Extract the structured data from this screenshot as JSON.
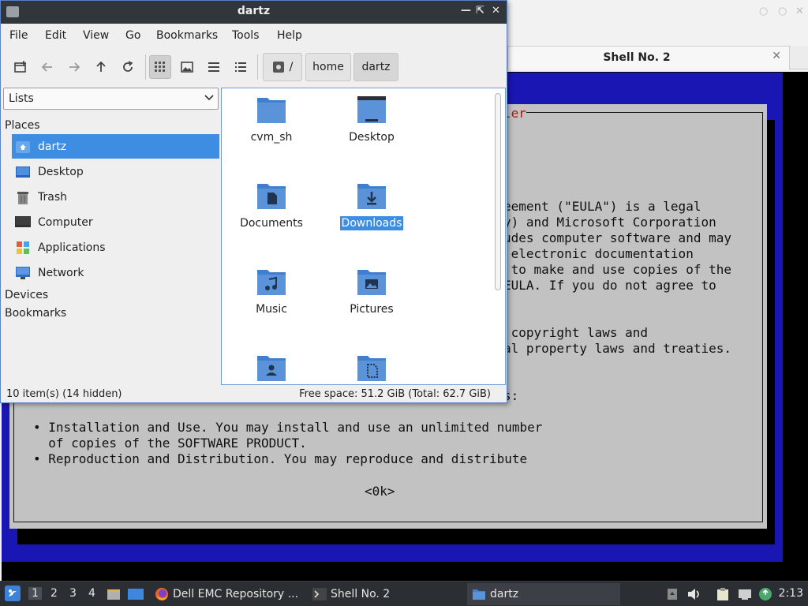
{
  "terminal": {
    "tab_label": "Shell No. 2",
    "dialog_title_fragment": "ler",
    "lines": [
      "eement (\"EULA\") is a legal",
      "y) and Microsoft Corporation",
      "udes computer software and may",
      " electronic documentation",
      " to make and use copies of the",
      "EULA. If you do not agree to",
      "",
      " copyright laws and",
      "al property laws and treaties.",
      "",
      "s:"
    ],
    "bullets": [
      "• Installation and Use. You may install and use an unlimited number",
      "  of copies of the SOFTWARE PRODUCT.",
      "• Reproduction and Distribution. You may reproduce and distribute"
    ],
    "ok_button": "<0k>"
  },
  "file_manager": {
    "title": "dartz",
    "menu": [
      "File",
      "Edit",
      "View",
      "Go",
      "Bookmarks",
      "Tools",
      "Help"
    ],
    "breadcrumb": {
      "root": "/",
      "items": [
        "home",
        "dartz"
      ]
    },
    "side_combo": "Lists",
    "side_sections": {
      "places": "Places",
      "devices": "Devices",
      "bookmarks": "Bookmarks"
    },
    "places": [
      {
        "label": "dartz",
        "icon": "home-folder-icon"
      },
      {
        "label": "Desktop",
        "icon": "desktop-icon"
      },
      {
        "label": "Trash",
        "icon": "trash-icon"
      },
      {
        "label": "Computer",
        "icon": "computer-icon"
      },
      {
        "label": "Applications",
        "icon": "applications-icon"
      },
      {
        "label": "Network",
        "icon": "network-icon"
      }
    ],
    "files": [
      {
        "name": "cvm_sh",
        "icon": "folder-icon"
      },
      {
        "name": "Desktop",
        "icon": "desktop-folder-icon"
      },
      {
        "name": "Documents",
        "icon": "documents-folder-icon"
      },
      {
        "name": "Downloads",
        "icon": "downloads-folder-icon"
      },
      {
        "name": "Music",
        "icon": "music-folder-icon"
      },
      {
        "name": "Pictures",
        "icon": "pictures-folder-icon"
      },
      {
        "name": "",
        "icon": "public-folder-icon"
      },
      {
        "name": "",
        "icon": "templates-folder-icon"
      }
    ],
    "selected_file": "Downloads",
    "status_left": "10 item(s) (14 hidden)",
    "status_right": "Free space: 51.2 GiB (Total: 62.7 GiB)"
  },
  "taskbar": {
    "workspaces": [
      "1",
      "2",
      "3",
      "4"
    ],
    "tasks": [
      {
        "label": "Dell EMC Repository ...",
        "icon": "firefox-icon"
      },
      {
        "label": "Shell No. 2",
        "icon": "terminal-icon"
      },
      {
        "label": "dartz",
        "icon": "folder-icon"
      }
    ],
    "clock": "2:13"
  },
  "colors": {
    "accent": "#3d8ee3",
    "folder": "#5b93d8",
    "terminal_blue": "#1a16b4",
    "dialog_gray": "#c2c2c2",
    "titlebar": "#31363b"
  }
}
